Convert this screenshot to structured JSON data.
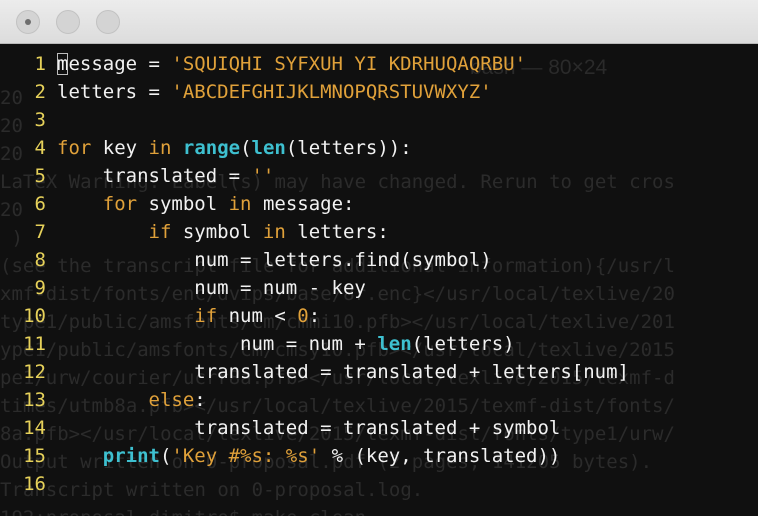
{
  "window": {
    "buttons": [
      {
        "name": "close",
        "color": "#d4d4d4"
      },
      {
        "name": "minimize",
        "color": "#d4d4d4"
      },
      {
        "name": "zoom",
        "color": "#d4d4d4"
      }
    ]
  },
  "background_terminal": {
    "title": "bash — 80×24",
    "lines": [
      "20",
      "20",
      "20",
      "LaTeX Warning: Label(s) may have changed. Rerun to get cros",
      "20",
      " )",
      "(see the transcript file for additional information){/usr/l",
      "xmf-dist/fonts/enc/dvips/base/8r.enc}</usr/local/texlive/20",
      "type1/public/amsfonts/cm/cmmi10.pfb></usr/local/texlive/201",
      "ype1/public/amsfonts/cm/cmsy10.pfb></usr/local/texlive/2015",
      "pe1/urw/courier/ucrr8a.pfb></usr/local/texlive/2015/texmf-d",
      "times/utmb8a.pfb></usr/local/texlive/2015/texmf-dist/fonts/",
      "8a.pfb></usr/local/texlive/2015/texmf-dist/fonts/type1/urw/",
      "Output written on 0-proposal.pdf (2 pages, 141205 bytes).",
      "Transcript written on 0-proposal.log.",
      "192:proposal dimitro$ make clean"
    ]
  },
  "editor": {
    "colors": {
      "line_number": "#e6d15a",
      "keyword": "#e0a13a",
      "string": "#e0a13a",
      "builtin": "#3ec0d0",
      "text": "#f2f2f2"
    },
    "lines": [
      {
        "num": "1",
        "indent": "",
        "tokens": [
          {
            "t": "m",
            "type": "cursor"
          },
          {
            "t": "essage = ",
            "type": "p"
          },
          {
            "t": "'SQUIQHI SYFXUH YI KDRHUQAQRBU'",
            "type": "str"
          }
        ]
      },
      {
        "num": "2",
        "indent": "",
        "tokens": [
          {
            "t": "letters = ",
            "type": "p"
          },
          {
            "t": "'ABCDEFGHIJKLMNOPQRSTUVWXYZ'",
            "type": "str"
          }
        ]
      },
      {
        "num": "3",
        "indent": "",
        "tokens": []
      },
      {
        "num": "4",
        "indent": "",
        "tokens": [
          {
            "t": "for",
            "type": "kw"
          },
          {
            "t": " key ",
            "type": "p"
          },
          {
            "t": "in",
            "type": "kw"
          },
          {
            "t": " ",
            "type": "p"
          },
          {
            "t": "range",
            "type": "bi"
          },
          {
            "t": "(",
            "type": "p"
          },
          {
            "t": "len",
            "type": "bi"
          },
          {
            "t": "(letters)):",
            "type": "p"
          }
        ]
      },
      {
        "num": "5",
        "indent": "    ",
        "tokens": [
          {
            "t": "translated = ",
            "type": "p"
          },
          {
            "t": "''",
            "type": "str"
          }
        ]
      },
      {
        "num": "6",
        "indent": "    ",
        "tokens": [
          {
            "t": "for",
            "type": "kw"
          },
          {
            "t": " symbol ",
            "type": "p"
          },
          {
            "t": "in",
            "type": "kw"
          },
          {
            "t": " message:",
            "type": "p"
          }
        ]
      },
      {
        "num": "7",
        "indent": "        ",
        "tokens": [
          {
            "t": "if",
            "type": "kw"
          },
          {
            "t": " symbol ",
            "type": "p"
          },
          {
            "t": "in",
            "type": "kw"
          },
          {
            "t": " letters:",
            "type": "p"
          }
        ]
      },
      {
        "num": "8",
        "indent": "            ",
        "tokens": [
          {
            "t": "num = letters.find(symbol)",
            "type": "p"
          }
        ]
      },
      {
        "num": "9",
        "indent": "            ",
        "tokens": [
          {
            "t": "num = num - key",
            "type": "p"
          }
        ]
      },
      {
        "num": "10",
        "indent": "            ",
        "tokens": [
          {
            "t": "if",
            "type": "kw"
          },
          {
            "t": " num < ",
            "type": "p"
          },
          {
            "t": "0",
            "type": "num"
          },
          {
            "t": ":",
            "type": "p"
          }
        ]
      },
      {
        "num": "11",
        "indent": "                ",
        "tokens": [
          {
            "t": "num = num + ",
            "type": "p"
          },
          {
            "t": "len",
            "type": "bi"
          },
          {
            "t": "(letters)",
            "type": "p"
          }
        ]
      },
      {
        "num": "12",
        "indent": "            ",
        "tokens": [
          {
            "t": "translated = translated + letters[num]",
            "type": "p"
          }
        ]
      },
      {
        "num": "13",
        "indent": "        ",
        "tokens": [
          {
            "t": "else",
            "type": "kw"
          },
          {
            "t": ":",
            "type": "p"
          }
        ]
      },
      {
        "num": "14",
        "indent": "            ",
        "tokens": [
          {
            "t": "translated = translated + symbol",
            "type": "p"
          }
        ]
      },
      {
        "num": "15",
        "indent": "    ",
        "tokens": [
          {
            "t": "print",
            "type": "bi"
          },
          {
            "t": "(",
            "type": "p"
          },
          {
            "t": "'Key #%s: %s'",
            "type": "str"
          },
          {
            "t": " % (key, translated))",
            "type": "p"
          }
        ]
      },
      {
        "num": "16",
        "indent": "",
        "tokens": []
      }
    ]
  }
}
